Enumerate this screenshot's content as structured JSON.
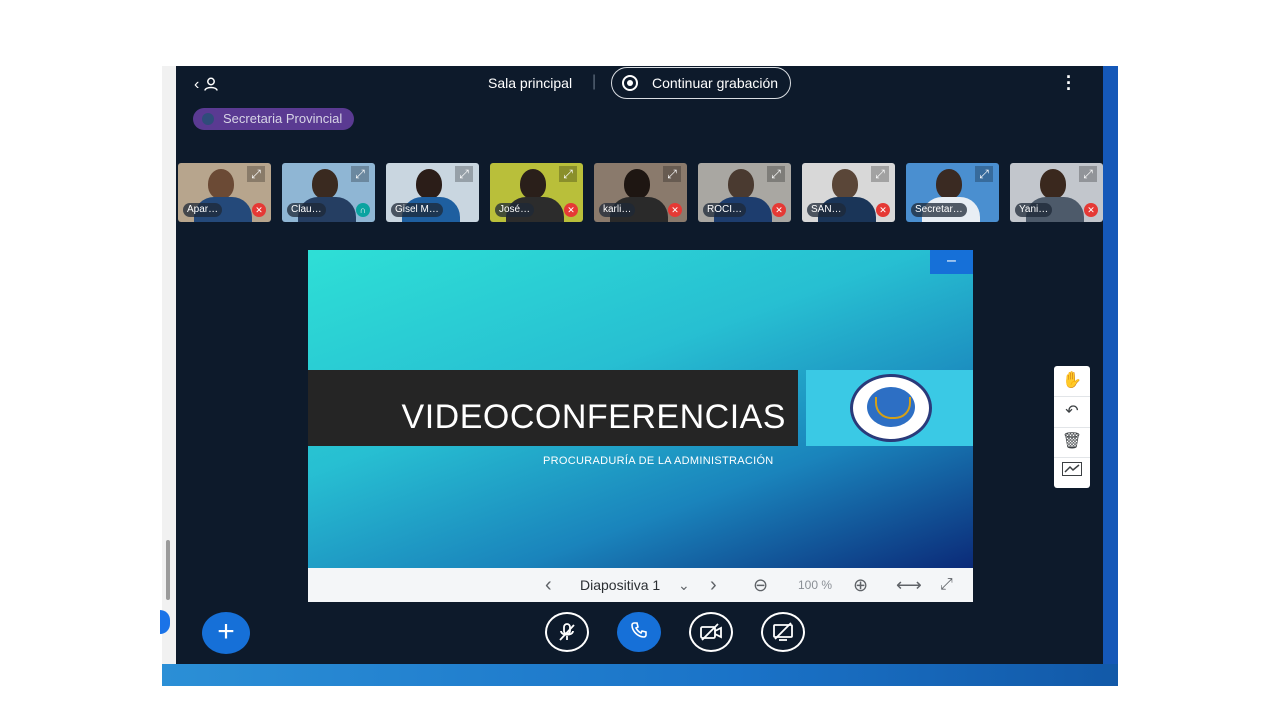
{
  "header": {
    "room_label": "Sala principal",
    "separator": "|",
    "record_label": "Continuar grabación"
  },
  "group_badge": {
    "label": "Secretaria Provincial"
  },
  "participants": [
    {
      "name": "Apar…",
      "status": "muted"
    },
    {
      "name": "Clau…",
      "status": "audio"
    },
    {
      "name": "Gisel M…",
      "status": "none"
    },
    {
      "name": "José…",
      "status": "muted"
    },
    {
      "name": "karli…",
      "status": "muted"
    },
    {
      "name": "ROCI…",
      "status": "muted"
    },
    {
      "name": "SAN…",
      "status": "muted"
    },
    {
      "name": "Secretar…",
      "status": "none"
    },
    {
      "name": "Yani…",
      "status": "muted"
    }
  ],
  "presentation": {
    "title": "VIDEOCONFERENCIAS",
    "subtitle": "PROCURADURÍA DE LA ADMINISTRACIÓN",
    "minimize_symbol": "–",
    "slide_label": "Diapositiva 1",
    "zoom_level": "100 %"
  },
  "icons": {
    "back": "chevron-left-icon",
    "user": "user-icon",
    "menu": "more-vertical-icon",
    "record": "record-icon",
    "hand": "hand-icon",
    "undo": "undo-icon",
    "delete": "trash-icon",
    "whiteboard": "chart-icon"
  },
  "colors": {
    "app_bg": "#0d1a2b",
    "accent": "#1670d8",
    "badge_bg": "#5a3a92",
    "muted_red": "#e53935"
  }
}
